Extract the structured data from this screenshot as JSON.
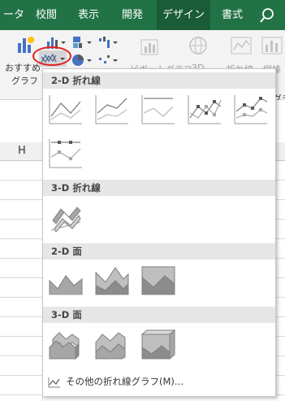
{
  "tabs": [
    {
      "label": "ータ",
      "active": false
    },
    {
      "label": "校閲",
      "active": false
    },
    {
      "label": "表示",
      "active": false
    },
    {
      "label": "開発",
      "active": false
    },
    {
      "label": "デザイン",
      "active": true
    },
    {
      "label": "書式",
      "active": false
    }
  ],
  "ribbon": {
    "recommended_label_1": "おすすめ",
    "recommended_label_2": "グラフ",
    "pivot_label": "ピボットグラフ",
    "three_d_label": "3D",
    "sparkline_line_label": "折れ線",
    "sparkline_col_label": "縦棒",
    "cut_label": "グラ"
  },
  "sheet": {
    "column_header": "H"
  },
  "gallery": {
    "sections": [
      {
        "title": "2-D 折れ線",
        "items": [
          "line-chart-icon",
          "stacked-line-chart-icon",
          "percent-stacked-line-chart-icon",
          "line-with-markers-chart-icon",
          "stacked-line-with-markers-chart-icon",
          "percent-stacked-line-with-markers-chart-icon"
        ]
      },
      {
        "title": "3-D 折れ線",
        "items": [
          "3d-line-chart-icon"
        ]
      },
      {
        "title": "2-D 面",
        "items": [
          "area-chart-icon",
          "stacked-area-chart-icon",
          "percent-stacked-area-chart-icon"
        ]
      },
      {
        "title": "3-D 面",
        "items": [
          "3d-area-chart-icon",
          "3d-stacked-area-chart-icon",
          "3d-percent-stacked-area-chart-icon"
        ]
      }
    ],
    "more_label": "その他の折れ線グラフ(M)..."
  },
  "colors": {
    "tab_bar": "#217346",
    "highlight_ring": "#e0201e"
  }
}
